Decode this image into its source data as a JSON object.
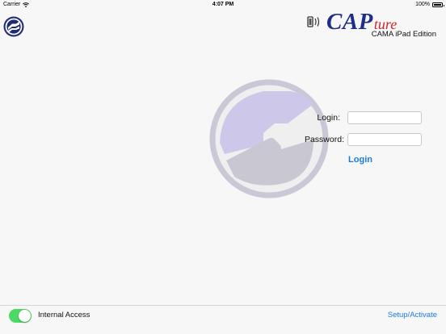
{
  "status_bar": {
    "carrier": "Carrier",
    "time": "4:07 PM",
    "battery": "100%"
  },
  "brand": {
    "wordmark_main": "CAP",
    "wordmark_script": "ture",
    "subtitle": "CAMA iPad Edition"
  },
  "form": {
    "login_label": "Login:",
    "password_label": "Password:",
    "login_value": "",
    "password_value": "",
    "submit_label": "Login"
  },
  "bottom_bar": {
    "toggle_label": "Internal Access",
    "toggle_on": true,
    "setup_link": "Setup/Activate"
  },
  "colors": {
    "accent_blue": "#1c7ce0",
    "toggle_green": "#4cd964",
    "brand_navy": "#1f2d8c",
    "brand_red": "#c8262c"
  },
  "icons": {
    "app_logo": "app-logo-icon",
    "device": "rfid-device-icon",
    "wifi": "wifi-icon",
    "battery": "battery-icon"
  }
}
